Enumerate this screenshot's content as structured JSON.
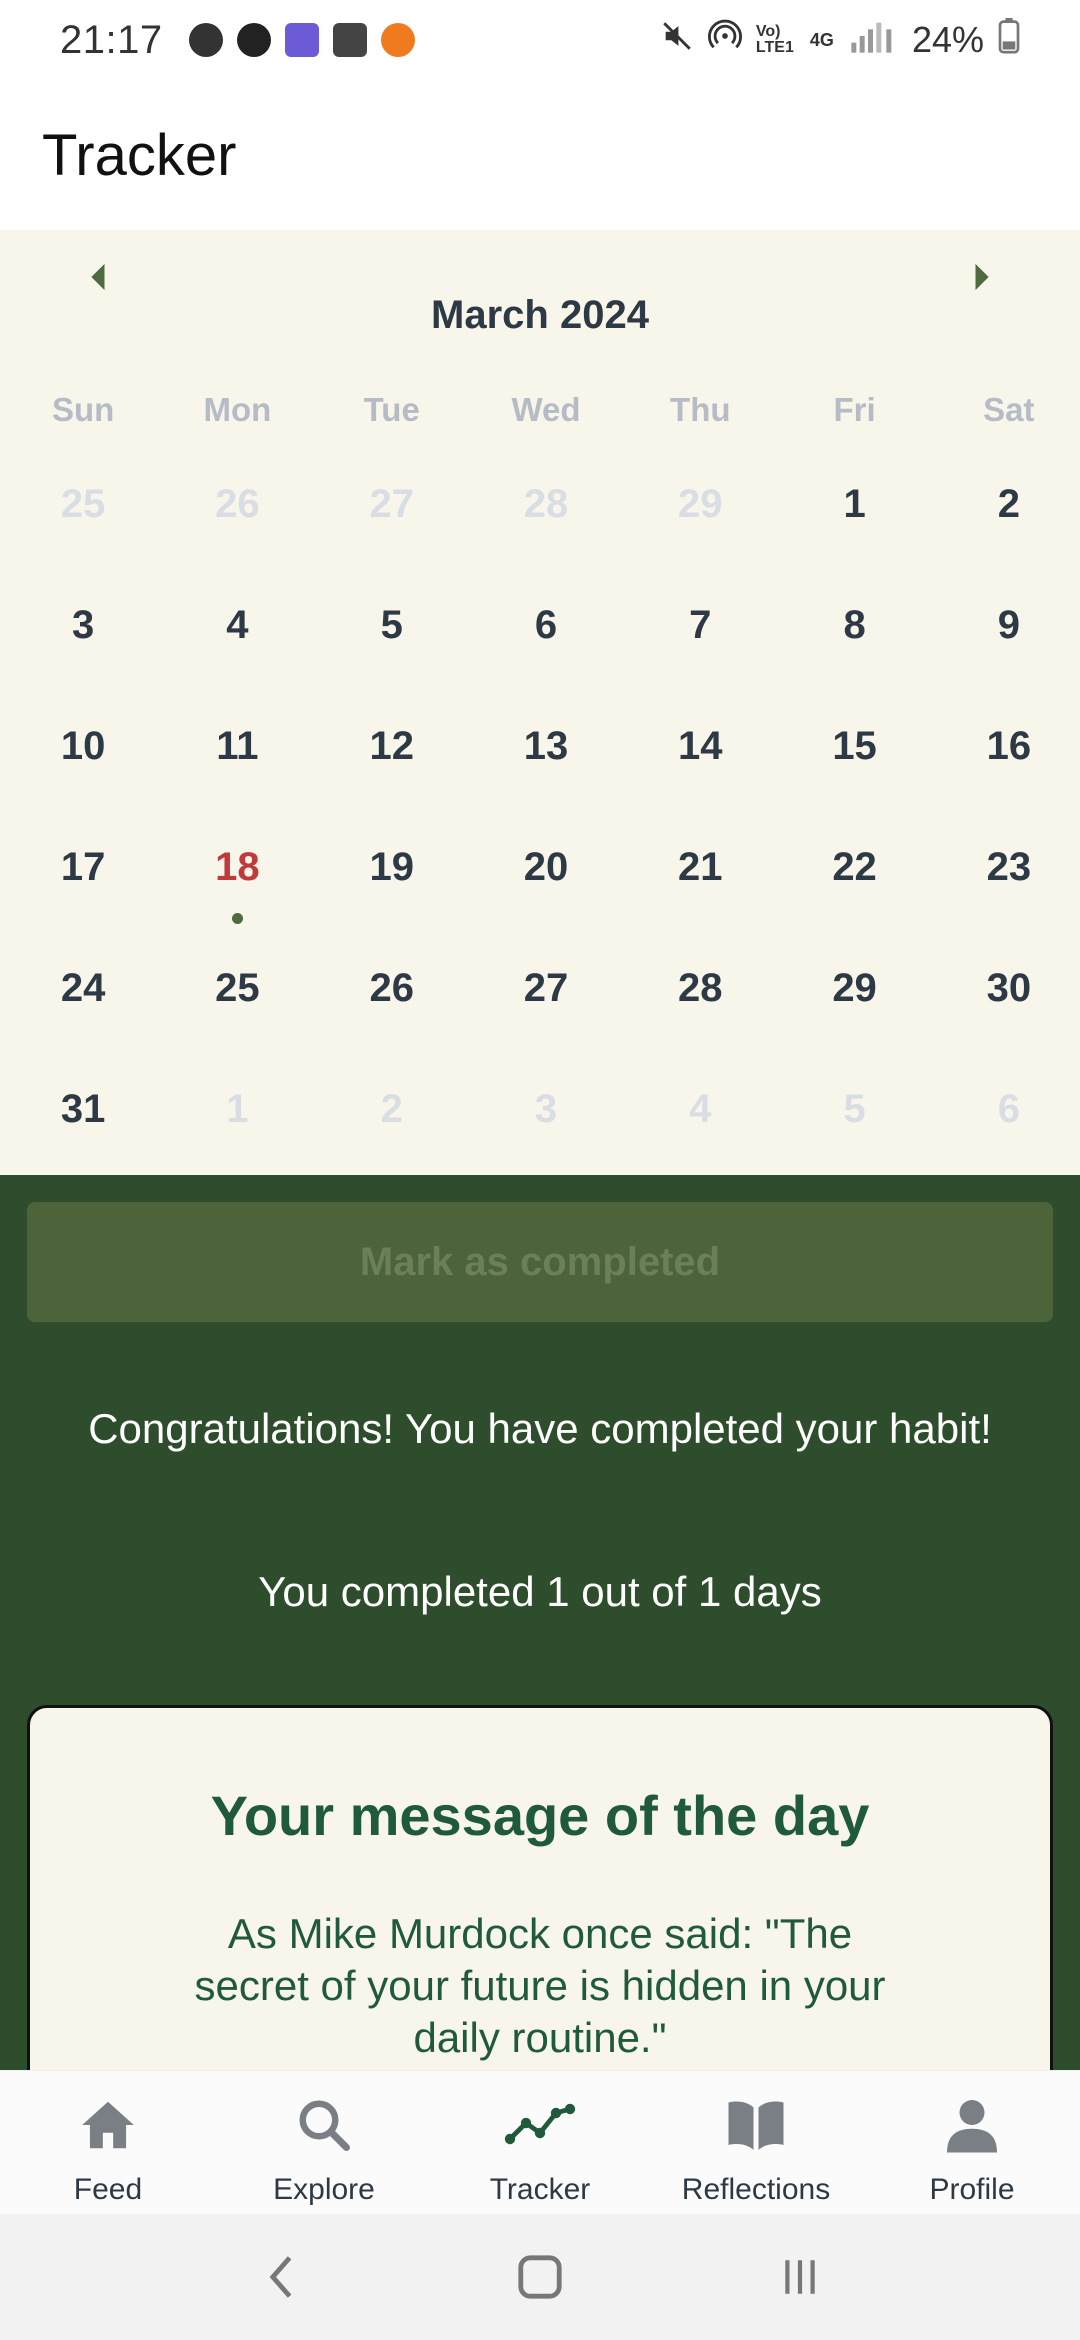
{
  "status_bar": {
    "time": "21:17",
    "battery": "24%",
    "network": "4G",
    "volte": "Vo) LTE1"
  },
  "app_bar": {
    "title": "Tracker"
  },
  "calendar": {
    "month": "March 2024",
    "weekdays": [
      "Sun",
      "Mon",
      "Tue",
      "Wed",
      "Thu",
      "Fri",
      "Sat"
    ],
    "days": [
      {
        "n": "25",
        "muted": true
      },
      {
        "n": "26",
        "muted": true
      },
      {
        "n": "27",
        "muted": true
      },
      {
        "n": "28",
        "muted": true
      },
      {
        "n": "29",
        "muted": true
      },
      {
        "n": "1"
      },
      {
        "n": "2"
      },
      {
        "n": "3"
      },
      {
        "n": "4"
      },
      {
        "n": "5"
      },
      {
        "n": "6"
      },
      {
        "n": "7"
      },
      {
        "n": "8"
      },
      {
        "n": "9"
      },
      {
        "n": "10"
      },
      {
        "n": "11"
      },
      {
        "n": "12"
      },
      {
        "n": "13"
      },
      {
        "n": "14"
      },
      {
        "n": "15"
      },
      {
        "n": "16"
      },
      {
        "n": "17"
      },
      {
        "n": "18",
        "today": true,
        "marked": true
      },
      {
        "n": "19"
      },
      {
        "n": "20"
      },
      {
        "n": "21"
      },
      {
        "n": "22"
      },
      {
        "n": "23"
      },
      {
        "n": "24"
      },
      {
        "n": "25"
      },
      {
        "n": "26"
      },
      {
        "n": "27"
      },
      {
        "n": "28"
      },
      {
        "n": "29"
      },
      {
        "n": "30"
      },
      {
        "n": "31"
      },
      {
        "n": "1",
        "muted": true
      },
      {
        "n": "2",
        "muted": true
      },
      {
        "n": "3",
        "muted": true
      },
      {
        "n": "4",
        "muted": true
      },
      {
        "n": "5",
        "muted": true
      },
      {
        "n": "6",
        "muted": true
      }
    ]
  },
  "habit": {
    "mark_button": "Mark as completed",
    "congrats": "Congratulations! You have completed your habit!",
    "completed_text": "You completed 1 out of 1 days"
  },
  "message_card": {
    "title": "Your message of the day",
    "body": "As Mike Murdock once said: \"The secret of your future is hidden in your daily routine.\""
  },
  "bottom_nav": {
    "items": [
      {
        "label": "Feed",
        "icon": "home-icon"
      },
      {
        "label": "Explore",
        "icon": "search-icon"
      },
      {
        "label": "Tracker",
        "icon": "trend-icon",
        "active": true
      },
      {
        "label": "Reflections",
        "icon": "book-icon"
      },
      {
        "label": "Profile",
        "icon": "person-icon"
      }
    ]
  },
  "colors": {
    "calendar_bg": "#f8f5ea",
    "green_bg": "#2e4d2c",
    "today": "#c0393b",
    "accent_green": "#1f5a3a"
  }
}
